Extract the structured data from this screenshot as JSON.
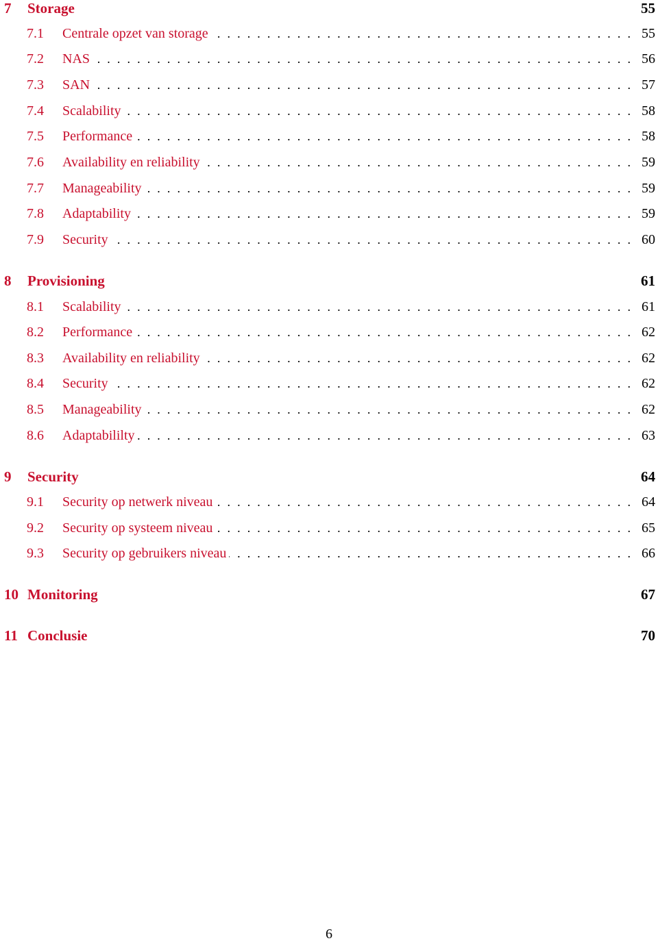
{
  "accent_color": "#c8102e",
  "toc": [
    {
      "num": "7",
      "title": "Storage",
      "page": "55",
      "sections": [
        {
          "num": "7.1",
          "title": "Centrale opzet van storage",
          "page": "55"
        },
        {
          "num": "7.2",
          "title": "NAS",
          "page": "56"
        },
        {
          "num": "7.3",
          "title": "SAN",
          "page": "57"
        },
        {
          "num": "7.4",
          "title": "Scalability",
          "page": "58"
        },
        {
          "num": "7.5",
          "title": "Performance",
          "page": "58"
        },
        {
          "num": "7.6",
          "title": "Availability en reliability",
          "page": "59"
        },
        {
          "num": "7.7",
          "title": "Manageability",
          "page": "59"
        },
        {
          "num": "7.8",
          "title": "Adaptability",
          "page": "59"
        },
        {
          "num": "7.9",
          "title": "Security",
          "page": "60"
        }
      ]
    },
    {
      "num": "8",
      "title": "Provisioning",
      "page": "61",
      "sections": [
        {
          "num": "8.1",
          "title": "Scalability",
          "page": "61"
        },
        {
          "num": "8.2",
          "title": "Performance",
          "page": "62"
        },
        {
          "num": "8.3",
          "title": "Availability en reliability",
          "page": "62"
        },
        {
          "num": "8.4",
          "title": "Security",
          "page": "62"
        },
        {
          "num": "8.5",
          "title": "Manageability",
          "page": "62"
        },
        {
          "num": "8.6",
          "title": "Adaptabililty",
          "page": "63"
        }
      ]
    },
    {
      "num": "9",
      "title": "Security",
      "page": "64",
      "sections": [
        {
          "num": "9.1",
          "title": "Security op netwerk niveau",
          "page": "64"
        },
        {
          "num": "9.2",
          "title": "Security op systeem niveau",
          "page": "65"
        },
        {
          "num": "9.3",
          "title": "Security op gebruikers niveau",
          "page": "66"
        }
      ]
    },
    {
      "num": "10",
      "title": "Monitoring",
      "page": "67",
      "sections": []
    },
    {
      "num": "11",
      "title": "Conclusie",
      "page": "70",
      "sections": []
    }
  ],
  "footer": {
    "page_number": "6"
  }
}
